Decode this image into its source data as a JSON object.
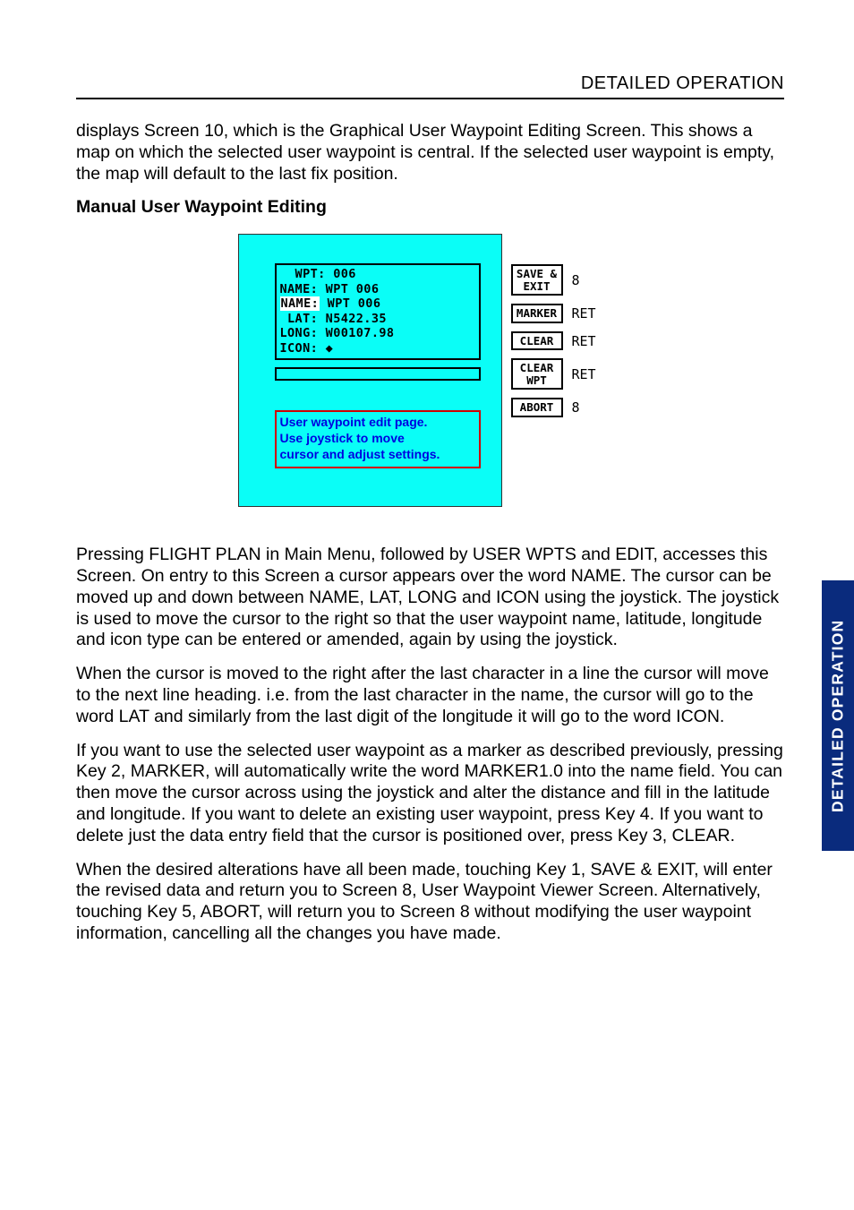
{
  "header": {
    "right": "DETAILED OPERATION"
  },
  "intro": "displays Screen 10, which is the Graphical User Waypoint Editing Screen.  This shows a map on which the selected user waypoint is central. If the selected user waypoint is empty, the map will default to the last fix position.",
  "heading": "Manual User Waypoint Editing",
  "lcd": {
    "wpt": "  WPT: 006",
    "name": "NAME: WPT 006",
    "name2_label": "NAME:",
    "name2_value": " WPT 006",
    "lat": " LAT: N5422.35",
    "long": "LONG: W00107.98",
    "icon": "ICON: ◆",
    "help1": "User waypoint edit page.",
    "help2": "Use joystick to move",
    "help3": "cursor and adjust settings."
  },
  "buttons": [
    {
      "label": "SAVE &\nEXIT",
      "ret": "8"
    },
    {
      "label": "MARKER",
      "ret": "RET"
    },
    {
      "label": "CLEAR",
      "ret": "RET"
    },
    {
      "label": "CLEAR\nWPT",
      "ret": "RET"
    },
    {
      "label": "ABORT",
      "ret": "8"
    }
  ],
  "para1": "Pressing FLIGHT PLAN in Main Menu, followed by USER WPTS and EDIT, accesses this Screen.  On entry to this Screen a cursor appears over the word NAME.  The cursor can be moved up and down between NAME, LAT, LONG and ICON using the joystick.  The joystick is used to move the cursor to the right so that the user waypoint name, latitude, longitude and icon type can be entered or amended, again by using the joystick.",
  "para2": "When the cursor is moved to the right after the last character in a line the cursor will move to the next line heading. i.e. from the last character in the name, the cursor will go to the word LAT and similarly from the last digit of the longitude it will go to the word ICON.",
  "para3": "If you want to use the selected user waypoint as a marker as described previously, pressing Key 2, MARKER, will automatically write the word MARKER1.0 into the name field.  You can then move the cursor across using the joystick and alter the distance and fill in the latitude and longitude.  If you want to delete an existing user waypoint, press Key 4.  If you want to delete just the data entry field that the cursor is positioned over, press Key 3, CLEAR.",
  "para4": "When the desired alterations have all been made, touching Key 1, SAVE & EXIT, will enter the revised data and return you to Screen 8, User Waypoint Viewer Screen.  Alternatively, touching Key 5, ABORT, will return you to Screen 8 without modifying the user waypoint information, cancelling all the changes you have made.",
  "sidetab": "DETAILED OPERATION"
}
